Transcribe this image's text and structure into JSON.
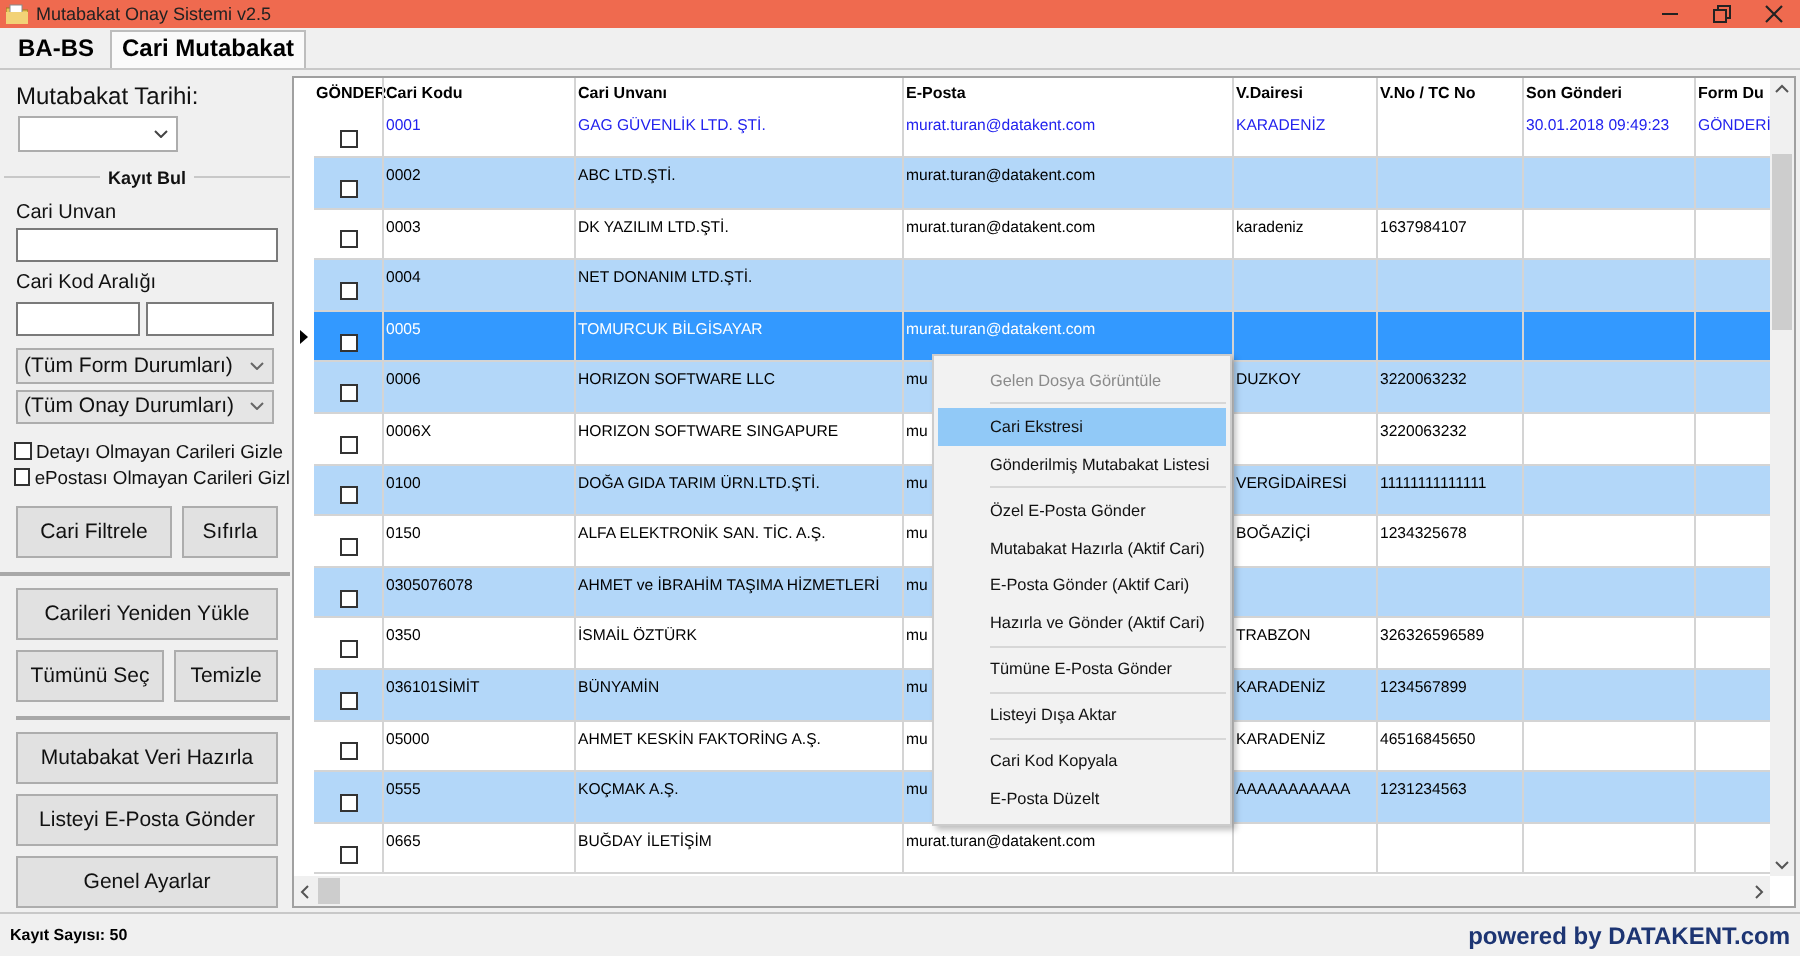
{
  "window": {
    "title": "Mutabakat Onay Sistemi v2.5"
  },
  "tabs": [
    {
      "label": "BA-BS",
      "selected": false
    },
    {
      "label": "Cari Mutabakat",
      "selected": true
    }
  ],
  "sidebar": {
    "date_label": "Mutabakat Tarihi:",
    "search": {
      "title": "Kayıt Bul",
      "name_label": "Cari Unvan",
      "code_range_label": "Cari Kod Aralığı",
      "dropdowns": [
        "(Tüm Form Durumları)",
        "(Tüm Onay Durumları)"
      ],
      "checkboxes": [
        {
          "label": "Detayı Olmayan Carileri Gizle",
          "checked": false
        },
        {
          "label": "ePostası Olmayan Carileri Gizl",
          "checked": false
        }
      ],
      "buttons": [
        "Cari Filtrele",
        "Sıfırla"
      ]
    },
    "sections": [
      {
        "rows": [
          [
            "Carileri Yeniden Yükle"
          ],
          [
            "Tümünü Seç",
            "Temizle"
          ]
        ]
      },
      {
        "rows": [
          [
            "Mutabakat Veri Hazırla"
          ],
          [
            "Listeyi E-Posta Gönder"
          ],
          [
            "Genel Ayarlar"
          ]
        ]
      }
    ]
  },
  "table": {
    "columns": [
      "GÖNDER",
      "Cari Kodu",
      "Cari Unvanı",
      "E-Posta",
      "V.Dairesi",
      "V.No / TC No",
      "Son Gönderi",
      "Form Du"
    ],
    "rows": [
      {
        "checked": false,
        "selected": false,
        "sent": true,
        "code": "0001",
        "name": "GAG GÜVENLİK LTD. ŞTİ.",
        "email": "murat.turan@datakent.com",
        "tax_office": "KARADENİZ",
        "last_sent": "30.01.2018 09:49:23",
        "form_status": "GÖNDERİ"
      },
      {
        "checked": false,
        "selected": false,
        "sent": false,
        "code": "0002",
        "name": "ABC LTD.ŞTİ.",
        "email": "murat.turan@datakent.com"
      },
      {
        "checked": false,
        "selected": false,
        "sent": false,
        "code": "0003",
        "name": "DK YAZILIM LTD.ŞTİ.",
        "email": "murat.turan@datakent.com",
        "tax_office": "karadeniz",
        "tax_no": "1637984107"
      },
      {
        "checked": false,
        "selected": false,
        "sent": false,
        "code": "0004",
        "name": "NET DONANIM LTD.ŞTİ."
      },
      {
        "checked": false,
        "selected": true,
        "sent": false,
        "code": "0005",
        "name": "TOMURCUK BİLGİSAYAR",
        "email": "murat.turan@datakent.com"
      },
      {
        "checked": false,
        "selected": false,
        "sent": false,
        "code": "0006",
        "name": "HORIZON SOFTWARE LLC",
        "email": "mu",
        "tax_office": "DUZKOY",
        "tax_no": "3220063232"
      },
      {
        "checked": false,
        "selected": false,
        "sent": false,
        "code": "0006X",
        "name": "HORIZON SOFTWARE SINGAPURE",
        "email": "mu",
        "tax_no": "3220063232"
      },
      {
        "checked": false,
        "selected": false,
        "sent": false,
        "code": "0100",
        "name": "DOĞA GIDA TARIM ÜRN.LTD.ŞTİ.",
        "email": "mu",
        "tax_office": "VERGİDAİRESİ",
        "tax_no": "11111111111111"
      },
      {
        "checked": false,
        "selected": false,
        "sent": false,
        "code": "0150",
        "name": "ALFA ELEKTRONİK SAN. TİC. A.Ş.",
        "email": "mu",
        "tax_office": "BOĞAZİÇİ",
        "tax_no": "1234325678"
      },
      {
        "checked": false,
        "selected": false,
        "sent": false,
        "code": "0305076078",
        "name": "AHMET ve İBRAHİM TAŞIMA HİZMETLERİ",
        "email": "mu"
      },
      {
        "checked": false,
        "selected": false,
        "sent": false,
        "code": "0350",
        "name": "İSMAİL ÖZTÜRK",
        "email": "mu",
        "tax_office": "TRABZON",
        "tax_no": "326326596589"
      },
      {
        "checked": false,
        "selected": false,
        "sent": false,
        "code": "036101SİMİT",
        "name": "BÜNYAMİN",
        "email": "mu",
        "tax_office": "KARADENİZ",
        "tax_no": "1234567899"
      },
      {
        "checked": false,
        "selected": false,
        "sent": false,
        "code": "05000",
        "name": "AHMET KESKİN FAKTORİNG A.Ş.",
        "email": "mu",
        "tax_office": "KARADENİZ",
        "tax_no": "46516845650"
      },
      {
        "checked": false,
        "selected": false,
        "sent": false,
        "code": "0555",
        "name": "KOÇMAK A.Ş.",
        "email": "mu",
        "tax_office": "AAAAAAAAAAA",
        "tax_no": "1231234563"
      },
      {
        "checked": false,
        "selected": false,
        "sent": false,
        "code": "0665",
        "name": "BUĞDAY İLETİŞİM",
        "email": "murat.turan@datakent.com"
      }
    ]
  },
  "context_menu": {
    "items": [
      {
        "kind": "item",
        "label": "Gelen Dosya Görüntüle",
        "disabled": true,
        "selected": false
      },
      {
        "kind": "separator"
      },
      {
        "kind": "item",
        "label": "Cari Ekstresi",
        "disabled": false,
        "selected": true
      },
      {
        "kind": "item",
        "label": "Gönderilmiş Mutabakat Listesi",
        "disabled": false,
        "selected": false
      },
      {
        "kind": "separator"
      },
      {
        "kind": "item",
        "label": "Özel E-Posta Gönder",
        "disabled": false,
        "selected": false
      },
      {
        "kind": "item",
        "label": "Mutabakat Hazırla (Aktif Cari)",
        "disabled": false,
        "selected": false
      },
      {
        "kind": "item",
        "label": "E-Posta Gönder (Aktif Cari)",
        "disabled": false,
        "selected": false
      },
      {
        "kind": "item",
        "label": "Hazırla ve Gönder (Aktif Cari)",
        "disabled": false,
        "selected": false
      },
      {
        "kind": "separator"
      },
      {
        "kind": "item",
        "label": "Tümüne E-Posta Gönder",
        "disabled": false,
        "selected": false
      },
      {
        "kind": "separator"
      },
      {
        "kind": "item",
        "label": "Listeyi Dışa Aktar",
        "disabled": false,
        "selected": false
      },
      {
        "kind": "separator"
      },
      {
        "kind": "item",
        "label": "Cari Kod Kopyala",
        "disabled": false,
        "selected": false
      },
      {
        "kind": "item",
        "label": "E-Posta Düzelt",
        "disabled": false,
        "selected": false
      }
    ]
  },
  "status_bar": {
    "record_count": "Kayıt Sayısı: 50",
    "brand": "powered by DATAKENT.com"
  }
}
